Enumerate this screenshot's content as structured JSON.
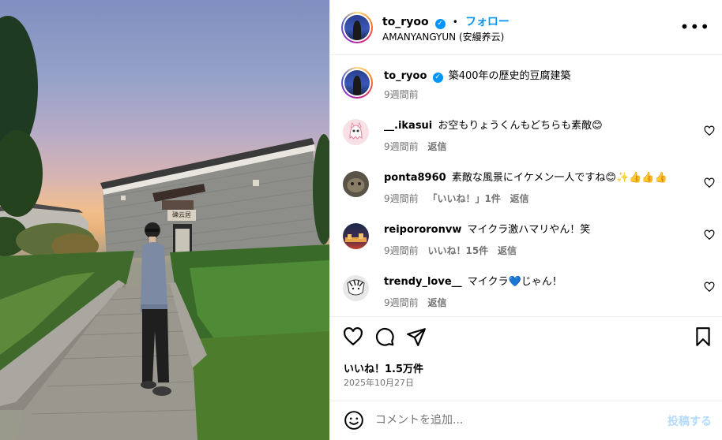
{
  "post": {
    "username": "to_ryoo",
    "verified_icon": "verified-check-icon",
    "follow_label": "フォロー",
    "separator": "•",
    "location": "AMANYANGYUN (安縵养云)",
    "more_icon": "more-options-icon"
  },
  "caption": {
    "username": "to_ryoo",
    "text": "築400年の歴史的豆腐建築",
    "time": "9週間前"
  },
  "comments": [
    {
      "username": "__.ikasui",
      "text": "お空もりょうくんもどちらも素敵😊",
      "time": "9週間前",
      "likes": "",
      "reply": "返信"
    },
    {
      "username": "ponta8960",
      "text": "素敵な風景にイケメン一人ですね😊✨👍👍👍",
      "time": "9週間前",
      "likes": "「いいね！」1件",
      "reply": "返信"
    },
    {
      "username": "reipororonvw",
      "text": "マイクラ激ハマリやん！笑",
      "time": "9週間前",
      "likes": "いいね！15件",
      "reply": "返信"
    },
    {
      "username": "trendy_love__",
      "text": "マイクラ💙じゃん！",
      "time": "9週間前",
      "likes": "",
      "reply": "返信"
    }
  ],
  "actions": {
    "like_icon": "heart-icon",
    "comment_icon": "comment-icon",
    "share_icon": "share-icon",
    "save_icon": "bookmark-icon"
  },
  "likes": "いいね！1.5万件",
  "date": "2025年10月27日",
  "composer": {
    "placeholder": "コメントを追加...",
    "post_label": "投稿する",
    "emoji_icon": "emoji-icon"
  },
  "photo": {
    "building_sign": "礫云居"
  },
  "colors": {
    "accent": "#0095f6",
    "muted": "#737373",
    "post_disabled": "#b3dbff",
    "border": "#efefef"
  }
}
